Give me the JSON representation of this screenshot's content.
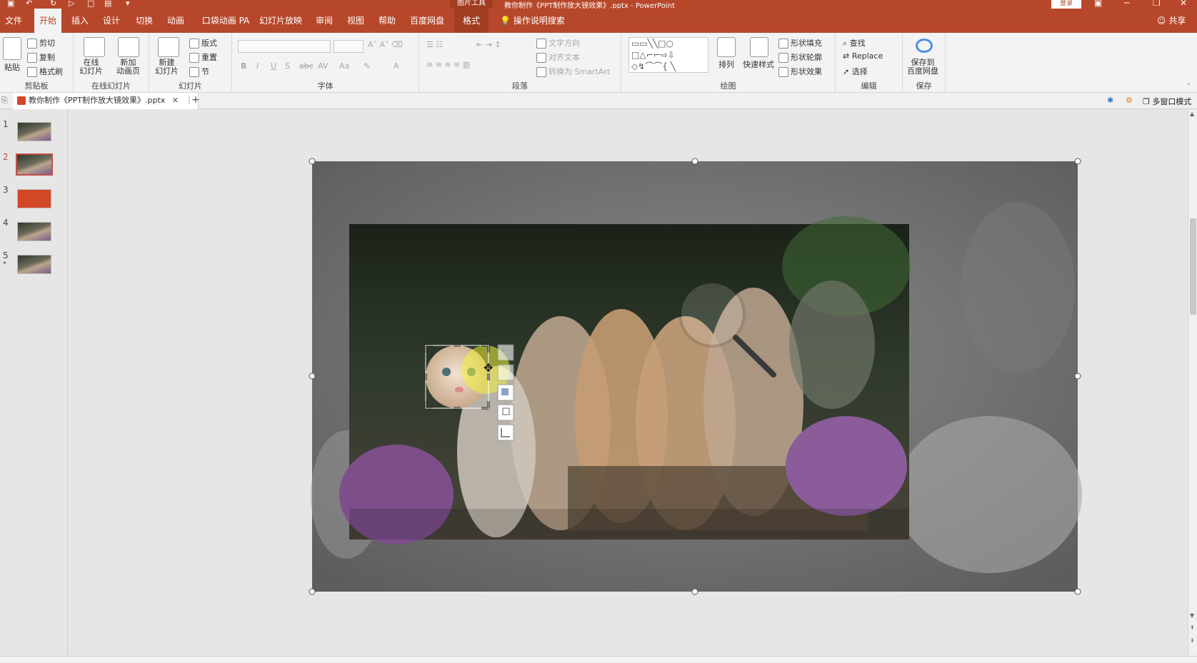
{
  "titlebar": {
    "context_tab": "图片工具",
    "title": "教你制作《PPT制作放大镜效果》.pptx - PowerPoint",
    "login": "登录"
  },
  "tabs": [
    "文件",
    "开始",
    "插入",
    "设计",
    "切换",
    "动画",
    "口袋动画 PA",
    "幻灯片放映",
    "审阅",
    "视图",
    "帮助",
    "百度网盘",
    "格式"
  ],
  "search_hint": "操作说明搜索",
  "share": "共享",
  "ribbon": {
    "clipboard": {
      "paste": "粘贴",
      "cut": "剪切",
      "copy": "复制",
      "painter": "格式刷",
      "label": "剪贴板"
    },
    "online": {
      "online_slide": "在线\n幻灯片",
      "new_anim": "新加\n动画页",
      "label": "在线幻灯片"
    },
    "slides": {
      "new_slide": "新建\n幻灯片",
      "layout": "版式",
      "reset": "重置",
      "section": "节",
      "label": "幻灯片"
    },
    "font": {
      "label": "字体"
    },
    "paragraph": {
      "text_dir": "文字方向",
      "align_text": "对齐文本",
      "smartart": "转换为 SmartArt",
      "label": "段落"
    },
    "drawing": {
      "arrange": "排列",
      "quick_styles": "快速样式",
      "fill": "形状填充",
      "outline": "形状轮廓",
      "effects": "形状效果",
      "label": "绘图"
    },
    "editing": {
      "find": "查找",
      "replace": "Replace",
      "select": "选择",
      "label": "编辑"
    },
    "save": {
      "save_baidu": "保存到\n百度网盘",
      "label": "保存"
    }
  },
  "doc_tab": "教你制作《PPT制作放大镜效果》.pptx",
  "multi_window": "多窗口模式",
  "thumbnails": [
    {
      "num": "1",
      "kind": "cat"
    },
    {
      "num": "2",
      "kind": "cat",
      "selected": true
    },
    {
      "num": "3",
      "kind": "red"
    },
    {
      "num": "4",
      "kind": "cat"
    },
    {
      "num": "5",
      "kind": "cat",
      "star": "*"
    }
  ],
  "colors": {
    "accent": "#b7472a",
    "ribbon": "#f3f3f3",
    "canvas": "#e6e6e6"
  }
}
